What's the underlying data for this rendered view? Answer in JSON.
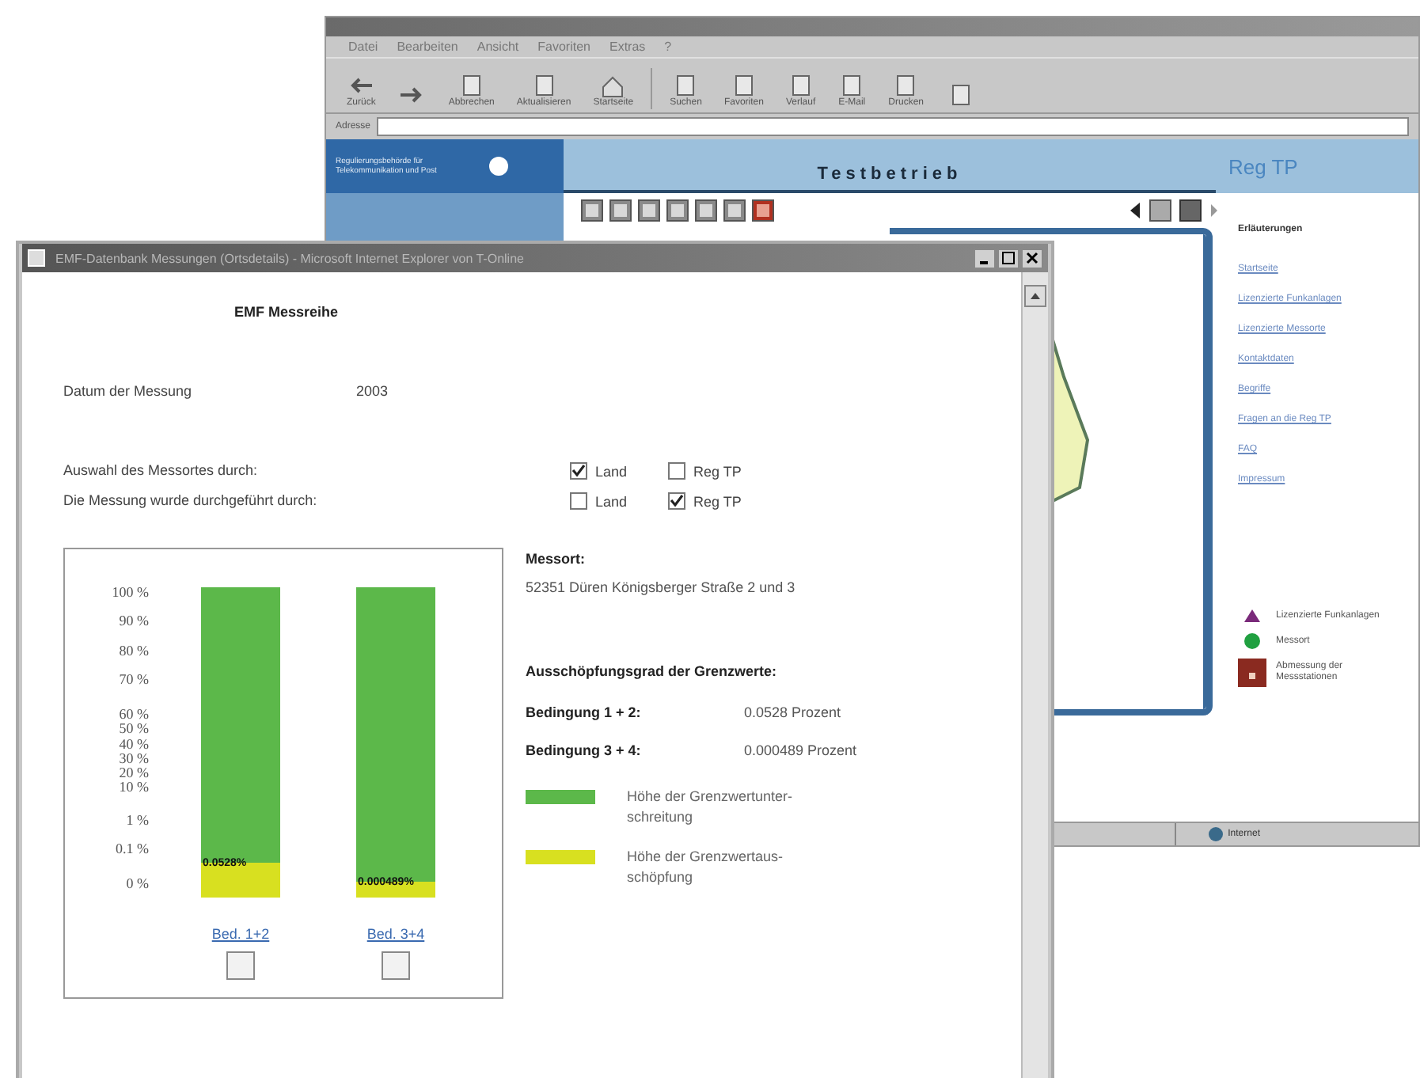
{
  "background_window": {
    "menu": [
      "Datei",
      "Bearbeiten",
      "Ansicht",
      "Favoriten",
      "Extras",
      "?"
    ],
    "toolbar": [
      {
        "label": "Zurück",
        "kind": "back"
      },
      {
        "kind": "forward"
      },
      {
        "label": "Abbrechen",
        "kind": "stop"
      },
      {
        "label": "Aktualisieren",
        "kind": "refresh"
      },
      {
        "label": "Startseite",
        "kind": "home"
      },
      {
        "label": "Suchen",
        "kind": "search"
      },
      {
        "label": "Favoriten",
        "kind": "favorites"
      },
      {
        "label": "Verlauf",
        "kind": "history"
      },
      {
        "label": "E-Mail",
        "kind": "mail"
      },
      {
        "label": "Drucken",
        "kind": "print"
      },
      {
        "kind": "edit"
      }
    ],
    "address_label": "Adresse",
    "site": {
      "logo_text": "Regulierungsbehörde für Telekommunikation und Post",
      "banner": "Testbetrieb",
      "brand": "Reg TP",
      "legend_title": "Erläuterungen",
      "links": [
        "Startseite",
        "Lizenzierte Funkanlagen",
        "Lizenzierte Messorte",
        "Kontaktdaten",
        "Begriffe",
        "Fragen an die Reg TP",
        "FAQ",
        "Impressum"
      ],
      "legend": [
        {
          "kind": "triangle",
          "label": "Lizenzierte Funkanlagen"
        },
        {
          "kind": "dot",
          "label": "Messort"
        },
        {
          "kind": "square",
          "label": "Abmessung der Messstationen"
        }
      ]
    },
    "status": "Internet"
  },
  "foreground_window": {
    "title": "EMF-Datenbank Messungen (Ortsdetails) - Microsoft Internet Explorer von T-Online",
    "heading": "EMF Messreihe",
    "date_label": "Datum der Messung",
    "date_value": "2003",
    "choice_rows": [
      {
        "label": "Auswahl des Messortes durch:",
        "options": [
          {
            "label": "Land",
            "checked": true
          },
          {
            "label": "Reg TP",
            "checked": false
          }
        ]
      },
      {
        "label": "Die Messung wurde durchgeführt durch:",
        "options": [
          {
            "label": "Land",
            "checked": false
          },
          {
            "label": "Reg TP",
            "checked": true
          }
        ]
      }
    ],
    "gauge_chart": {
      "axis_labels": [
        "100 %",
        "90 %",
        "80 %",
        "70 %",
        "60 %",
        "50 %",
        "40 %",
        "30 %",
        "20 %",
        "10 %",
        "1 %",
        "0.1 %",
        "0 %"
      ],
      "bars": [
        {
          "link": "Bed. 1+2",
          "value_label": "0.0528%",
          "level": 0.11,
          "checked": false
        },
        {
          "link": "Bed. 3+4",
          "value_label": "0.000489%",
          "level": 0.05,
          "checked": false
        }
      ]
    },
    "site_label": "Messort:",
    "site_value": "52351 Düren Königsberger Straße 2 und 3",
    "degree_title": "Ausschöpfungsgrad der Grenzwerte:",
    "conditions": [
      {
        "label": "Bedingung 1 + 2:",
        "value": "0.0528 Prozent"
      },
      {
        "label": "Bedingung 3 + 4:",
        "value": "0.000489 Prozent"
      }
    ],
    "legend": [
      {
        "color": "#5cb84a",
        "label": "Höhe der Grenzwertunter- schreitung"
      },
      {
        "color": "#d8e020",
        "label": "Höhe der Grenzwertaus- schöpfung"
      }
    ]
  }
}
